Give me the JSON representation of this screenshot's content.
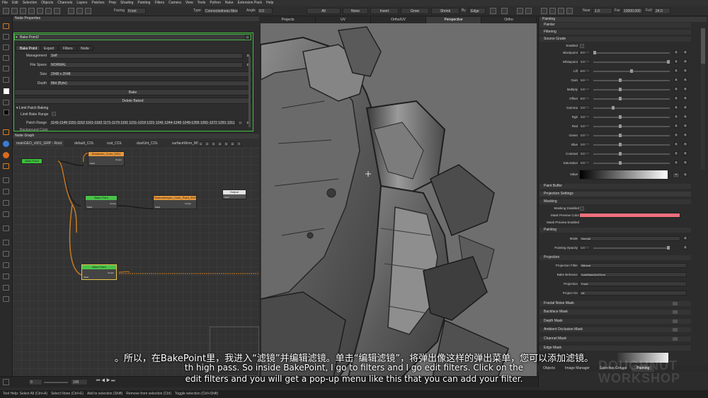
{
  "menubar": [
    "File",
    "Edit",
    "Selection",
    "Objects",
    "Channels",
    "Layers",
    "Patches",
    "Prep",
    "Shading",
    "Painting",
    "Filters",
    "Camera",
    "View",
    "Tools",
    "Python",
    "Nuke",
    "Extension Pack",
    "Help"
  ],
  "toolbar": {
    "facing_label": "Facing",
    "facing_value": "Front",
    "type_label": "Type",
    "type_value": "Connectedness Mesh",
    "angle_label": "Angle",
    "angle_value": "0.0",
    "all": "All",
    "none": "None",
    "invert": "Invert",
    "grow": "Grow",
    "shrink": "Shrink",
    "by_label": "By",
    "by_value": "Edge",
    "near_label": "Near",
    "near_value": "1.0",
    "far_label": "Far",
    "far_value": "10000.000",
    "fov_label": "FoV",
    "fov_value": "24.0"
  },
  "node_properties": {
    "title": "Node Properties",
    "node_name": "Bake Point2",
    "tabs": [
      "Bake Point",
      "Export",
      "Filters",
      "Node"
    ],
    "management_label": "Management",
    "management_value": "Self",
    "file_space_label": "File Space",
    "file_space_value": "NORMAL",
    "size_label": "Size",
    "size_value": "2048 x 2048",
    "depth_label": "Depth",
    "depth_value": "8bit (Byte)",
    "bake_label": "Bake",
    "delete_label": "Delete Baked",
    "limit_section": "Limit Patch Baking",
    "limit_checkbox": "Limit Bake Range",
    "patch_range_label": "Patch Range",
    "patch_range_value": "1141-1149 1151-1152 1161-1162 1171-1179 1191 1211-1219 1221 1241 1244-1246 1249-1255 1261-1272 1291 1311 1331",
    "background_label": "Background Color"
  },
  "node_graph": {
    "title": "Node Graph",
    "tabs": [
      "mainGEO_v001_GRP - Root",
      "default_COL",
      "rust_COL",
      "dustUnt_COL",
      "surfaceWorn_MSK"
    ],
    "nodes": [
      {
        "label": "Bake Point"
      },
      {
        "label": "Shadowm_Color_0001"
      },
      {
        "label": "Bake Point"
      },
      {
        "label": "Shadowkeeper_Color_Paint_0001"
      },
      {
        "label": "Output"
      },
      {
        "label": "Bake Point"
      }
    ],
    "ports": {
      "input": "Input",
      "output": "Output",
      "mask": "Mask"
    }
  },
  "viewport": {
    "tabs": [
      "Projects",
      "UV",
      "Ortho/UV",
      "Perspective",
      "Ortho"
    ],
    "active_tab": "Perspective"
  },
  "right_panel": {
    "title": "Painting",
    "sections": [
      "Painter",
      "Filtering",
      "Source Grade"
    ],
    "enabled_label": "Enabled",
    "grade_rows": [
      {
        "label": "Blackpoint",
        "value": "0.0"
      },
      {
        "label": "Whitepoint",
        "value": "1.0"
      },
      {
        "label": "Lift",
        "value": "0.0"
      },
      {
        "label": "Gain",
        "value": "1.0"
      },
      {
        "label": "Multiply",
        "value": "1.0"
      },
      {
        "label": "Offset",
        "value": "0.0"
      },
      {
        "label": "Gamma",
        "value": "1.0"
      },
      {
        "label": "Rgb",
        "value": "1.0"
      },
      {
        "label": "Red",
        "value": "1.0"
      },
      {
        "label": "Green",
        "value": "1.0"
      },
      {
        "label": "Blue",
        "value": "1.0"
      },
      {
        "label": "Contrast",
        "value": "1.0"
      },
      {
        "label": "Saturation",
        "value": "1.0"
      }
    ],
    "value_label": "Value",
    "paint_buffer": "Paint Buffer",
    "projection_settings": "Projection Settings",
    "masking": "Masking",
    "masking_disabled": "Masking Disabled",
    "mask_preview_color": "Mask Preview Color",
    "mask_preview_enabled": "Mask Preview Enabled",
    "painting": "Painting",
    "mode_label": "Mode",
    "mode_value": "Normal",
    "opacity_label": "Painting Opacity",
    "opacity_value": "1.0",
    "projection": "Projection",
    "projection_filter_label": "Projection Filter",
    "projection_filter_value": "Bilinear",
    "bake_behavior_label": "Bake Behavior",
    "bake_behavior_value": "AutoBakeAndClear",
    "projection_label": "Projection",
    "projection_value": "Front",
    "project_on_label": "Project On",
    "project_on_value": "All",
    "masks": [
      "Fractal Noise Mask",
      "Backface Mask",
      "Depth Mask",
      "Ambient Occlusion Mask",
      "Channel Mask",
      "Edge Mask"
    ],
    "bottom_tabs": [
      "Objects",
      "Image Manager",
      "Selection Groups",
      "Painting"
    ],
    "mask_color": "#f0707c"
  },
  "timeline": {
    "start": "0",
    "end": "100"
  },
  "status": {
    "tool_help": "Tool Help: Select All (Ctrl+A)",
    "select_none": "Select None (Ctrl+E)",
    "add": "Add to selection (Shift)",
    "remove": "Remove from selection (Ctrl)",
    "toggle": "Toggle selection (Ctrl+Shift)"
  },
  "subtitles": {
    "chinese": "。所以，在BakePoint里，我进入“滤镜”并编辑滤镜。单击“编辑滤镜”，将弹出像这样的弹出菜单，您可以添加滤镜。",
    "english1": "th high pass. So inside BakePoint, I go to filters and I go edit filters. Click on the",
    "english2": "edit filters and you will get a pop-up menu like this that you can add your filter."
  },
  "watermark": "DOUGHNUT WORKSHOP"
}
